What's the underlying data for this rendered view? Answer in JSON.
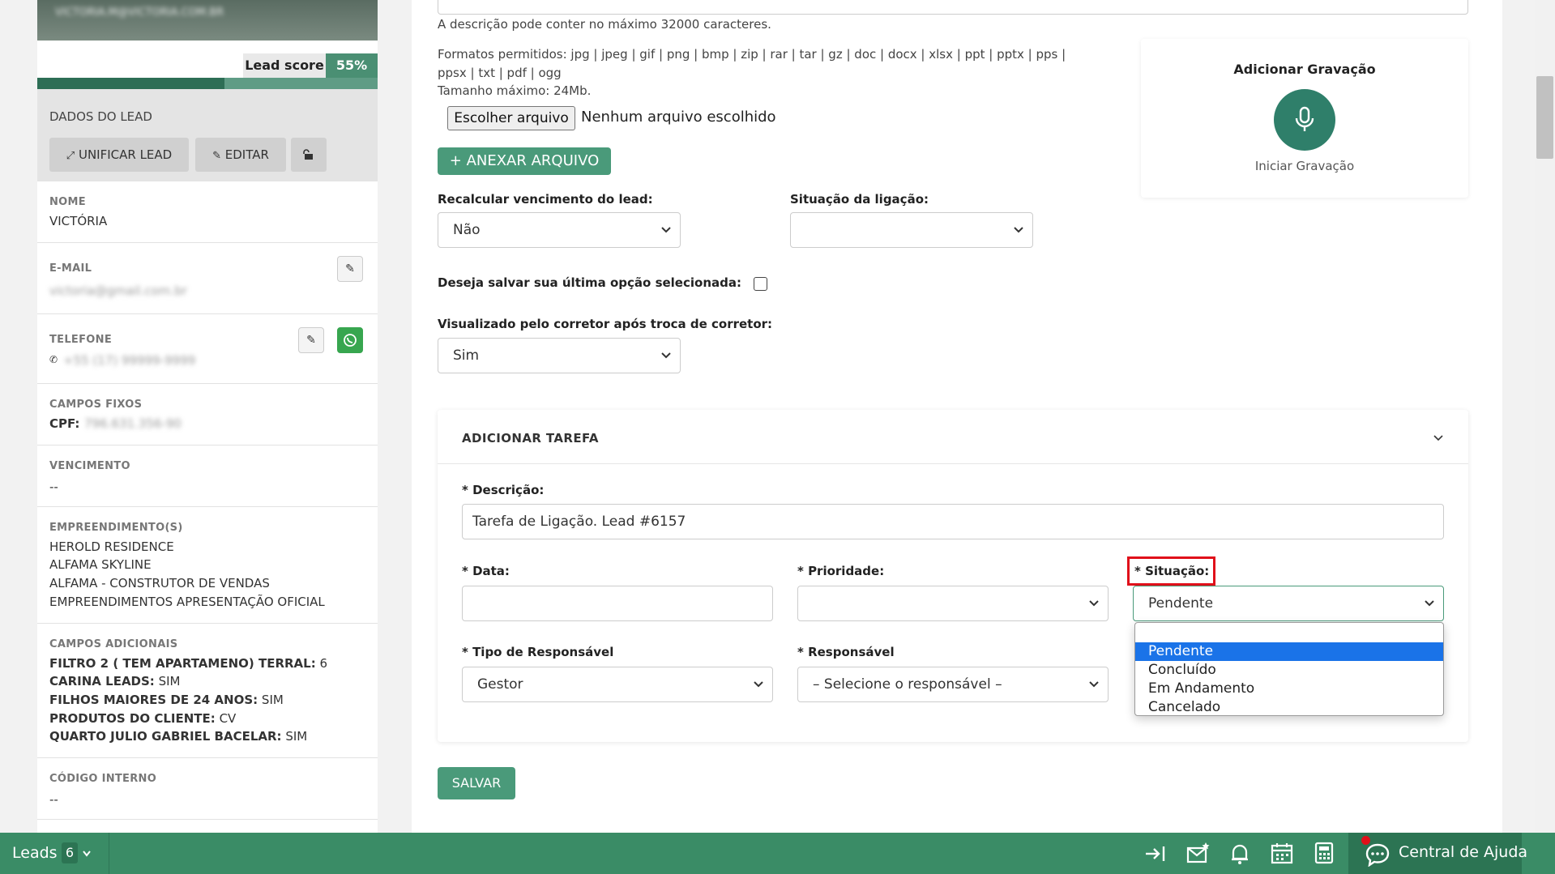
{
  "lead": {
    "hero_blurred": "VICTORIA.M@VICTORIA.COM.BR",
    "score_label": "Lead score",
    "score_value": "55%",
    "score_fraction": 0.55,
    "section_title": "DADOS DO LEAD",
    "btn_unify": "UNIFICAR LEAD",
    "btn_edit": "EDITAR",
    "fields": {
      "nome_label": "NOME",
      "nome_value": "VICTÓRIA",
      "email_label": "E-MAIL",
      "email_value": "victoria@gmail.com.br",
      "telefone_label": "TELEFONE",
      "telefone_value": "+55 (17) 99999-9999",
      "campos_fixos_label": "CAMPOS FIXOS",
      "cpf_label": "CPF:",
      "cpf_value": "796.631.356-90",
      "vencimento_label": "VENCIMENTO",
      "vencimento_value": "--",
      "empreendimentos_label": "EMPREENDIMENTO(S)",
      "empreendimentos": [
        "HEROLD RESIDENCE",
        "ALFAMA SKYLINE",
        "ALFAMA - CONSTRUTOR DE VENDAS",
        "EMPREENDIMENTOS APRESENTAÇÃO OFICIAL"
      ],
      "campos_adicionais_label": "CAMPOS ADICIONAIS",
      "adicionais": [
        {
          "k": "FILTRO 2 ( TEM APARTAMENO) TERRAL:",
          "v": "6"
        },
        {
          "k": "CARINA LEADS:",
          "v": "SIM"
        },
        {
          "k": "FILHOS MAIORES DE 24 ANOS:",
          "v": "SIM"
        },
        {
          "k": "PRODUTOS DO CLIENTE:",
          "v": "CV"
        },
        {
          "k": "QUARTO JULIO GABRIEL BACELAR:",
          "v": "SIM"
        }
      ],
      "codigo_label": "CÓDIGO INTERNO",
      "codigo_value": "--"
    }
  },
  "form": {
    "desc_hint": "A descrição pode conter no máximo 32000 caracteres.",
    "formats_line1": "Formatos permitidos: jpg | jpeg | gif | png | bmp | zip | rar | tar | gz | doc | docx | xlsx | ppt | pptx | pps |",
    "formats_line2": "ppsx | txt | pdf | ogg",
    "max_size": "Tamanho máximo: 24Mb.",
    "choose_file": "Escolher arquivo",
    "no_file": "Nenhum arquivo escolhido",
    "attach": "+ ANEXAR ARQUIVO",
    "recalc_label": "Recalcular vencimento do lead:",
    "recalc_value": "Não",
    "situacao_ligacao_label": "Situação da ligação:",
    "situacao_ligacao_value": "",
    "save_option_label": "Deseja salvar sua última opção selecionada:",
    "visualizado_label": "Visualizado pelo corretor após troca de corretor:",
    "visualizado_value": "Sim",
    "recording_title": "Adicionar Gravação",
    "recording_start": "Iniciar Gravação",
    "save_button": "SALVAR"
  },
  "task": {
    "header": "ADICIONAR TAREFA",
    "desc_label": "* Descrição:",
    "desc_value": "Tarefa de Ligação. Lead #6157",
    "data_label": "* Data:",
    "prioridade_label": "* Prioridade:",
    "situacao_label": "* Situação:",
    "situacao_value": "Pendente",
    "tipo_resp_label": "* Tipo de Responsável",
    "tipo_resp_value": "Gestor",
    "resp_label": "* Responsável",
    "resp_value": "– Selecione o responsável –",
    "situacao_options": [
      "Pendente",
      "Concluído",
      "Em Andamento",
      "Cancelado"
    ]
  },
  "bottom": {
    "leads_label": "Leads",
    "leads_count": "6",
    "help": "Central de Ajuda"
  },
  "colors": {
    "brand_green": "#3a8c66",
    "highlight_red": "#e0101a",
    "option_blue": "#1a73e8"
  }
}
